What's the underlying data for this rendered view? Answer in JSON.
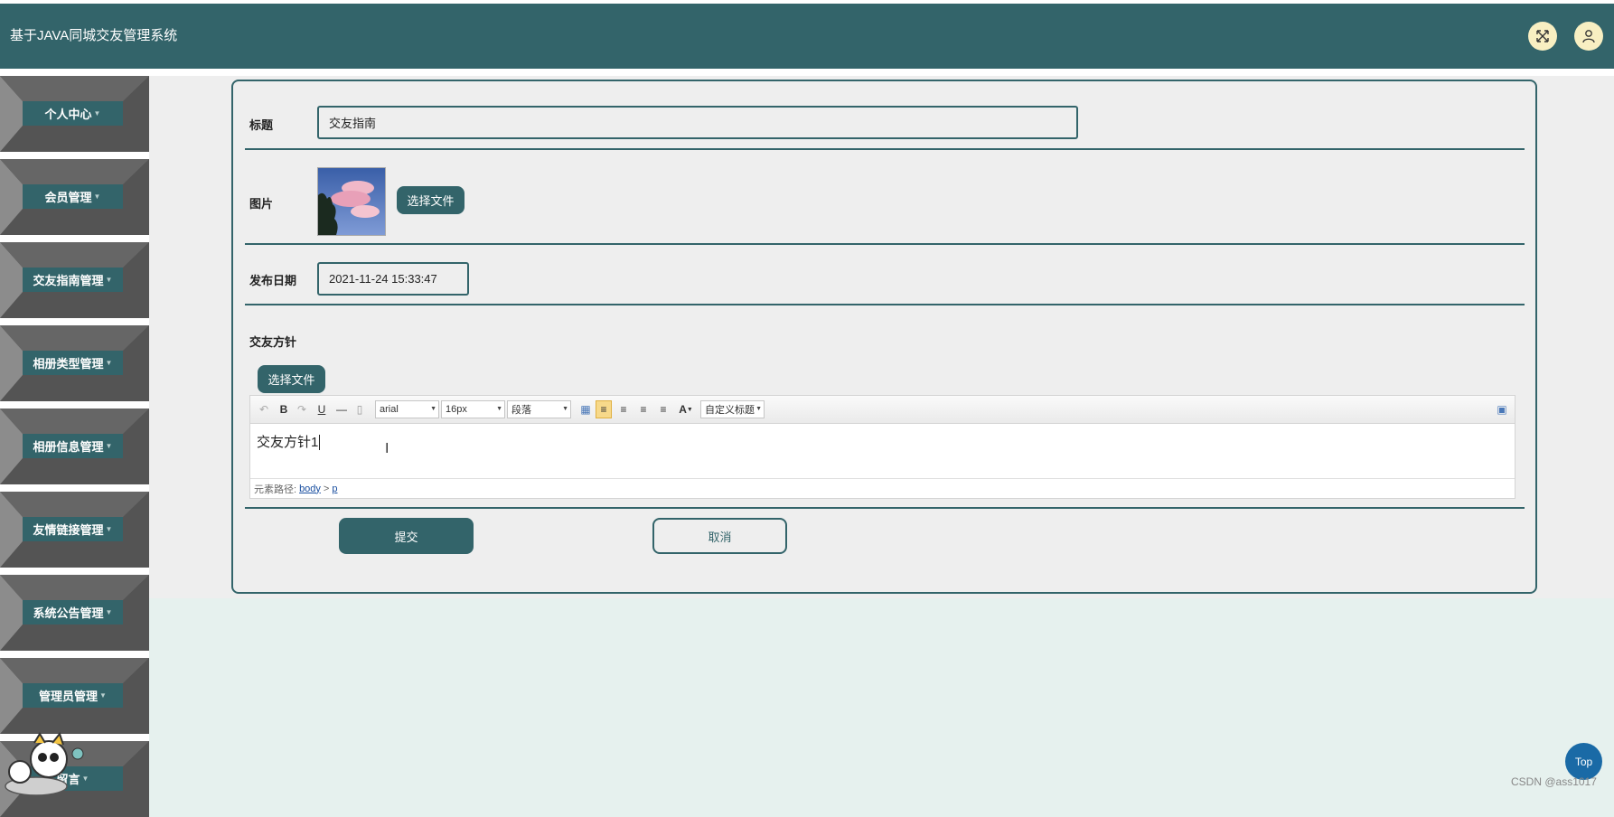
{
  "app": {
    "title": "基于JAVA同城交友管理系统"
  },
  "header": {
    "fullscreen_icon": "expand-icon",
    "user_icon": "user-icon"
  },
  "sidebar": {
    "items": [
      {
        "label": "个人中心"
      },
      {
        "label": "会员管理"
      },
      {
        "label": "交友指南管理"
      },
      {
        "label": "相册类型管理"
      },
      {
        "label": "相册信息管理"
      },
      {
        "label": "友情链接管理"
      },
      {
        "label": "系统公告管理"
      },
      {
        "label": "管理员管理"
      },
      {
        "label": "留言"
      }
    ]
  },
  "form": {
    "title_label": "标题",
    "title_value": "交友指南",
    "image_label": "图片",
    "choose_file": "选择文件",
    "date_label": "发布日期",
    "date_value": "2021-11-24 15:33:47",
    "policy_label": "交友方针",
    "editor": {
      "choose_file": "选择文件",
      "font_family": "arial",
      "font_size": "16px",
      "paragraph": "段落",
      "custom_title": "自定义标题",
      "content": "交友方针1",
      "path_label": "元素路径:",
      "path_body": "body",
      "path_sep": ">",
      "path_p": "p"
    },
    "submit": "提交",
    "cancel": "取消"
  },
  "top_button": "Top",
  "watermark": "CSDN @ass1017",
  "colors": {
    "primary": "#33646a",
    "accent": "#f8efc2"
  }
}
